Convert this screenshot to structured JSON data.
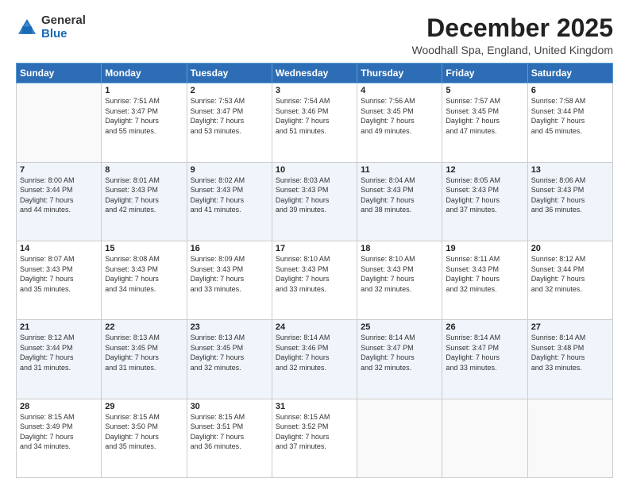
{
  "header": {
    "logo_general": "General",
    "logo_blue": "Blue",
    "month_title": "December 2025",
    "location": "Woodhall Spa, England, United Kingdom"
  },
  "days_of_week": [
    "Sunday",
    "Monday",
    "Tuesday",
    "Wednesday",
    "Thursday",
    "Friday",
    "Saturday"
  ],
  "weeks": [
    [
      {
        "day": "",
        "info": ""
      },
      {
        "day": "1",
        "info": "Sunrise: 7:51 AM\nSunset: 3:47 PM\nDaylight: 7 hours\nand 55 minutes."
      },
      {
        "day": "2",
        "info": "Sunrise: 7:53 AM\nSunset: 3:47 PM\nDaylight: 7 hours\nand 53 minutes."
      },
      {
        "day": "3",
        "info": "Sunrise: 7:54 AM\nSunset: 3:46 PM\nDaylight: 7 hours\nand 51 minutes."
      },
      {
        "day": "4",
        "info": "Sunrise: 7:56 AM\nSunset: 3:45 PM\nDaylight: 7 hours\nand 49 minutes."
      },
      {
        "day": "5",
        "info": "Sunrise: 7:57 AM\nSunset: 3:45 PM\nDaylight: 7 hours\nand 47 minutes."
      },
      {
        "day": "6",
        "info": "Sunrise: 7:58 AM\nSunset: 3:44 PM\nDaylight: 7 hours\nand 45 minutes."
      }
    ],
    [
      {
        "day": "7",
        "info": "Sunrise: 8:00 AM\nSunset: 3:44 PM\nDaylight: 7 hours\nand 44 minutes."
      },
      {
        "day": "8",
        "info": "Sunrise: 8:01 AM\nSunset: 3:43 PM\nDaylight: 7 hours\nand 42 minutes."
      },
      {
        "day": "9",
        "info": "Sunrise: 8:02 AM\nSunset: 3:43 PM\nDaylight: 7 hours\nand 41 minutes."
      },
      {
        "day": "10",
        "info": "Sunrise: 8:03 AM\nSunset: 3:43 PM\nDaylight: 7 hours\nand 39 minutes."
      },
      {
        "day": "11",
        "info": "Sunrise: 8:04 AM\nSunset: 3:43 PM\nDaylight: 7 hours\nand 38 minutes."
      },
      {
        "day": "12",
        "info": "Sunrise: 8:05 AM\nSunset: 3:43 PM\nDaylight: 7 hours\nand 37 minutes."
      },
      {
        "day": "13",
        "info": "Sunrise: 8:06 AM\nSunset: 3:43 PM\nDaylight: 7 hours\nand 36 minutes."
      }
    ],
    [
      {
        "day": "14",
        "info": "Sunrise: 8:07 AM\nSunset: 3:43 PM\nDaylight: 7 hours\nand 35 minutes."
      },
      {
        "day": "15",
        "info": "Sunrise: 8:08 AM\nSunset: 3:43 PM\nDaylight: 7 hours\nand 34 minutes."
      },
      {
        "day": "16",
        "info": "Sunrise: 8:09 AM\nSunset: 3:43 PM\nDaylight: 7 hours\nand 33 minutes."
      },
      {
        "day": "17",
        "info": "Sunrise: 8:10 AM\nSunset: 3:43 PM\nDaylight: 7 hours\nand 33 minutes."
      },
      {
        "day": "18",
        "info": "Sunrise: 8:10 AM\nSunset: 3:43 PM\nDaylight: 7 hours\nand 32 minutes."
      },
      {
        "day": "19",
        "info": "Sunrise: 8:11 AM\nSunset: 3:43 PM\nDaylight: 7 hours\nand 32 minutes."
      },
      {
        "day": "20",
        "info": "Sunrise: 8:12 AM\nSunset: 3:44 PM\nDaylight: 7 hours\nand 32 minutes."
      }
    ],
    [
      {
        "day": "21",
        "info": "Sunrise: 8:12 AM\nSunset: 3:44 PM\nDaylight: 7 hours\nand 31 minutes."
      },
      {
        "day": "22",
        "info": "Sunrise: 8:13 AM\nSunset: 3:45 PM\nDaylight: 7 hours\nand 31 minutes."
      },
      {
        "day": "23",
        "info": "Sunrise: 8:13 AM\nSunset: 3:45 PM\nDaylight: 7 hours\nand 32 minutes."
      },
      {
        "day": "24",
        "info": "Sunrise: 8:14 AM\nSunset: 3:46 PM\nDaylight: 7 hours\nand 32 minutes."
      },
      {
        "day": "25",
        "info": "Sunrise: 8:14 AM\nSunset: 3:47 PM\nDaylight: 7 hours\nand 32 minutes."
      },
      {
        "day": "26",
        "info": "Sunrise: 8:14 AM\nSunset: 3:47 PM\nDaylight: 7 hours\nand 33 minutes."
      },
      {
        "day": "27",
        "info": "Sunrise: 8:14 AM\nSunset: 3:48 PM\nDaylight: 7 hours\nand 33 minutes."
      }
    ],
    [
      {
        "day": "28",
        "info": "Sunrise: 8:15 AM\nSunset: 3:49 PM\nDaylight: 7 hours\nand 34 minutes."
      },
      {
        "day": "29",
        "info": "Sunrise: 8:15 AM\nSunset: 3:50 PM\nDaylight: 7 hours\nand 35 minutes."
      },
      {
        "day": "30",
        "info": "Sunrise: 8:15 AM\nSunset: 3:51 PM\nDaylight: 7 hours\nand 36 minutes."
      },
      {
        "day": "31",
        "info": "Sunrise: 8:15 AM\nSunset: 3:52 PM\nDaylight: 7 hours\nand 37 minutes."
      },
      {
        "day": "",
        "info": ""
      },
      {
        "day": "",
        "info": ""
      },
      {
        "day": "",
        "info": ""
      }
    ]
  ]
}
